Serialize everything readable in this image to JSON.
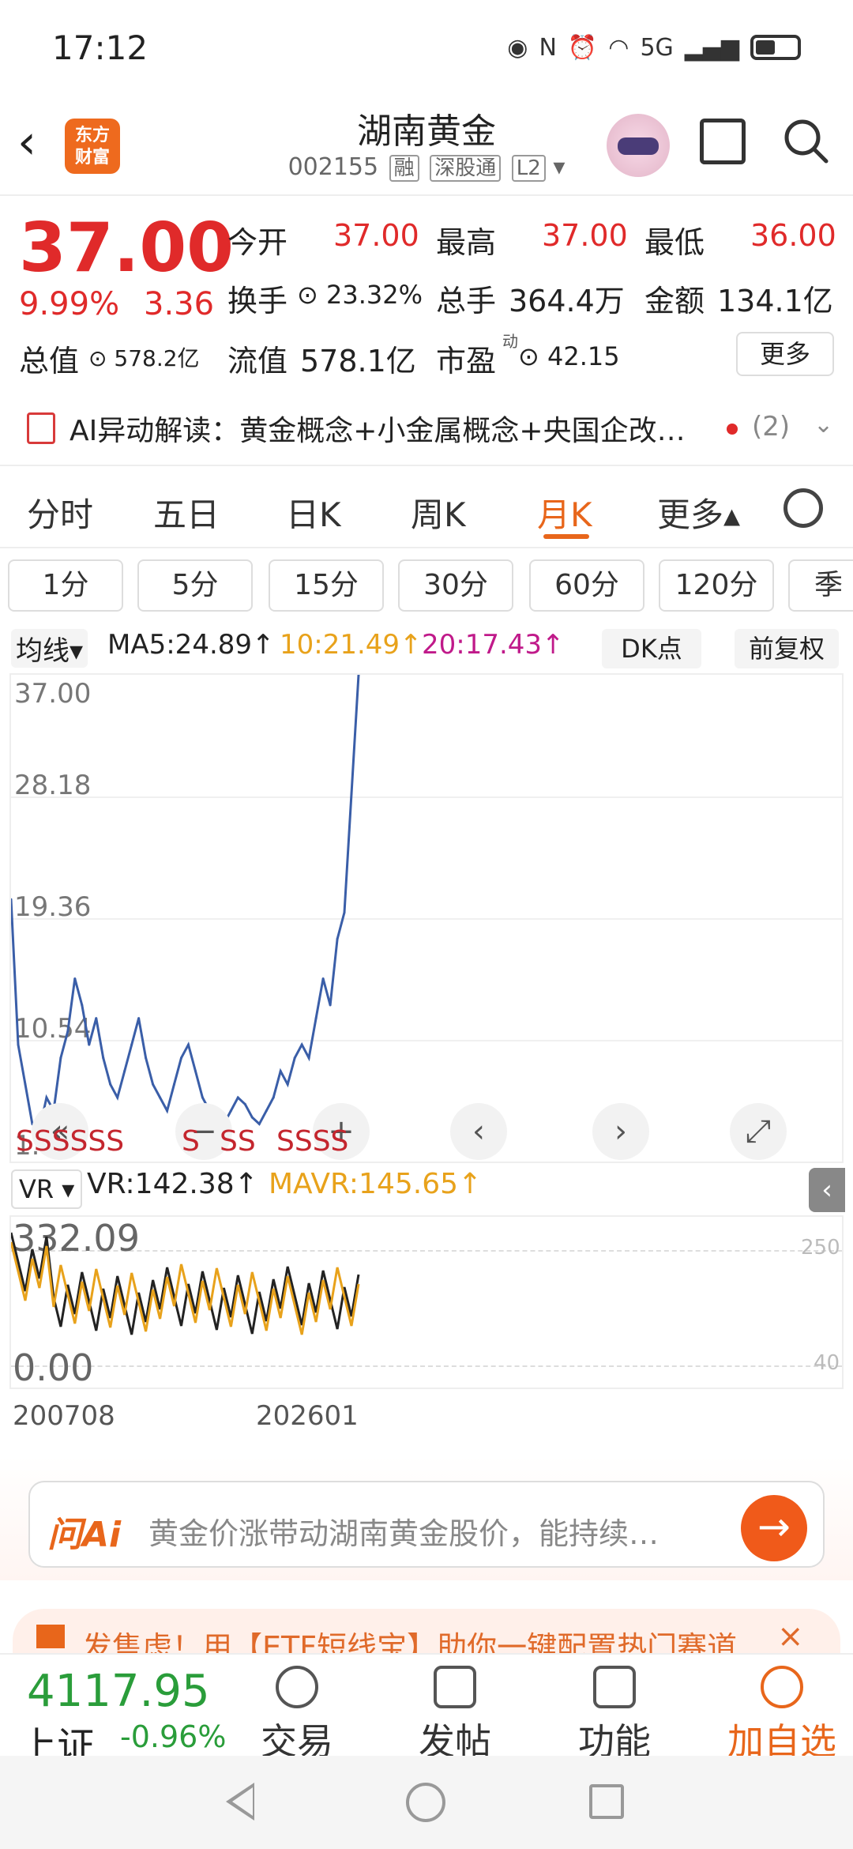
{
  "status": {
    "time": "17:12",
    "network": "5G"
  },
  "header": {
    "back": "‹",
    "logo_line1": "东方",
    "logo_line2": "财富",
    "title": "湖南黄金",
    "code": "002155",
    "tag1": "融",
    "tag2": "深股通",
    "tag3": "L2"
  },
  "quote": {
    "price": "37.00",
    "pct": "9.99%",
    "change": "3.36",
    "open_label": "今开",
    "open": "37.00",
    "high_label": "最高",
    "high": "37.00",
    "low_label": "最低",
    "low": "36.00",
    "turnover_label": "换手",
    "turnover": "23.32%",
    "volume_label": "总手",
    "volume": "364.4万",
    "amount_label": "金额",
    "amount": "134.1亿",
    "mcap_label": "总值",
    "mcap": "578.2亿",
    "float_label": "流值",
    "float": "578.1亿",
    "pe_label": "市盈",
    "pe_sup": "动",
    "pe": "42.15",
    "more": "更多"
  },
  "ai": {
    "text": "AI异动解读：黄金概念+小金属概念+央国企改…",
    "count": "(2)"
  },
  "tabs": [
    "分时",
    "五日",
    "日K",
    "周K",
    "月K",
    "更多▴"
  ],
  "intervals": [
    "1分",
    "5分",
    "15分",
    "30分",
    "60分",
    "120分",
    "季"
  ],
  "ma": {
    "label": "均线▾",
    "ma5": "MA5:24.89↑",
    "ma10": "10:21.49↑",
    "ma20": "20:17.43↑",
    "dk": "DK点",
    "adjust": "前复权"
  },
  "colors": {
    "up": "#e02a2a",
    "down": "#2a9d3a",
    "accent": "#e8661b",
    "ma5": "#222222",
    "ma10": "#e8a21b",
    "ma20": "#c01a8a"
  },
  "chart_data": {
    "type": "line",
    "y_ticks": [
      "37.00",
      "28.18",
      "19.36",
      "10.54",
      "1.71"
    ],
    "ylim": [
      1.71,
      37.0
    ],
    "series": [
      {
        "values": [
          20,
          9,
          6,
          3,
          2.5,
          5,
          4,
          8,
          10,
          14,
          12,
          9,
          11,
          8,
          6,
          5,
          7,
          9,
          11,
          8,
          6,
          5,
          4,
          6,
          8,
          9,
          7,
          5,
          4,
          3.5,
          3,
          4,
          5,
          4.5,
          3.5,
          3,
          4,
          5,
          7,
          6,
          8,
          9,
          8,
          11,
          14,
          12,
          17,
          19,
          28,
          37
        ]
      }
    ],
    "signals": [
      "SSSSSS",
      "S",
      "SS",
      "SSSS"
    ]
  },
  "vr": {
    "label": "VR",
    "vr": "VR:142.38↑",
    "mavr": "MAVR:145.65↑",
    "max": "332.09",
    "min": "0.00",
    "right_top": "250",
    "right_bottom": "40",
    "date_start": "200708",
    "date_end": "202601"
  },
  "ask": {
    "logo": "问Ai",
    "placeholder": "黄金价涨带动湖南黄金股价，能持续…"
  },
  "banner": {
    "text": "发售虑！用【ETF短线宝】助你一键配置热门赛道"
  },
  "bottom": {
    "index_value": "4117.95",
    "index_name": "上证",
    "index_pct": "-0.96%",
    "trade": "交易",
    "post": "发帖",
    "func": "功能",
    "watch": "加自选"
  }
}
